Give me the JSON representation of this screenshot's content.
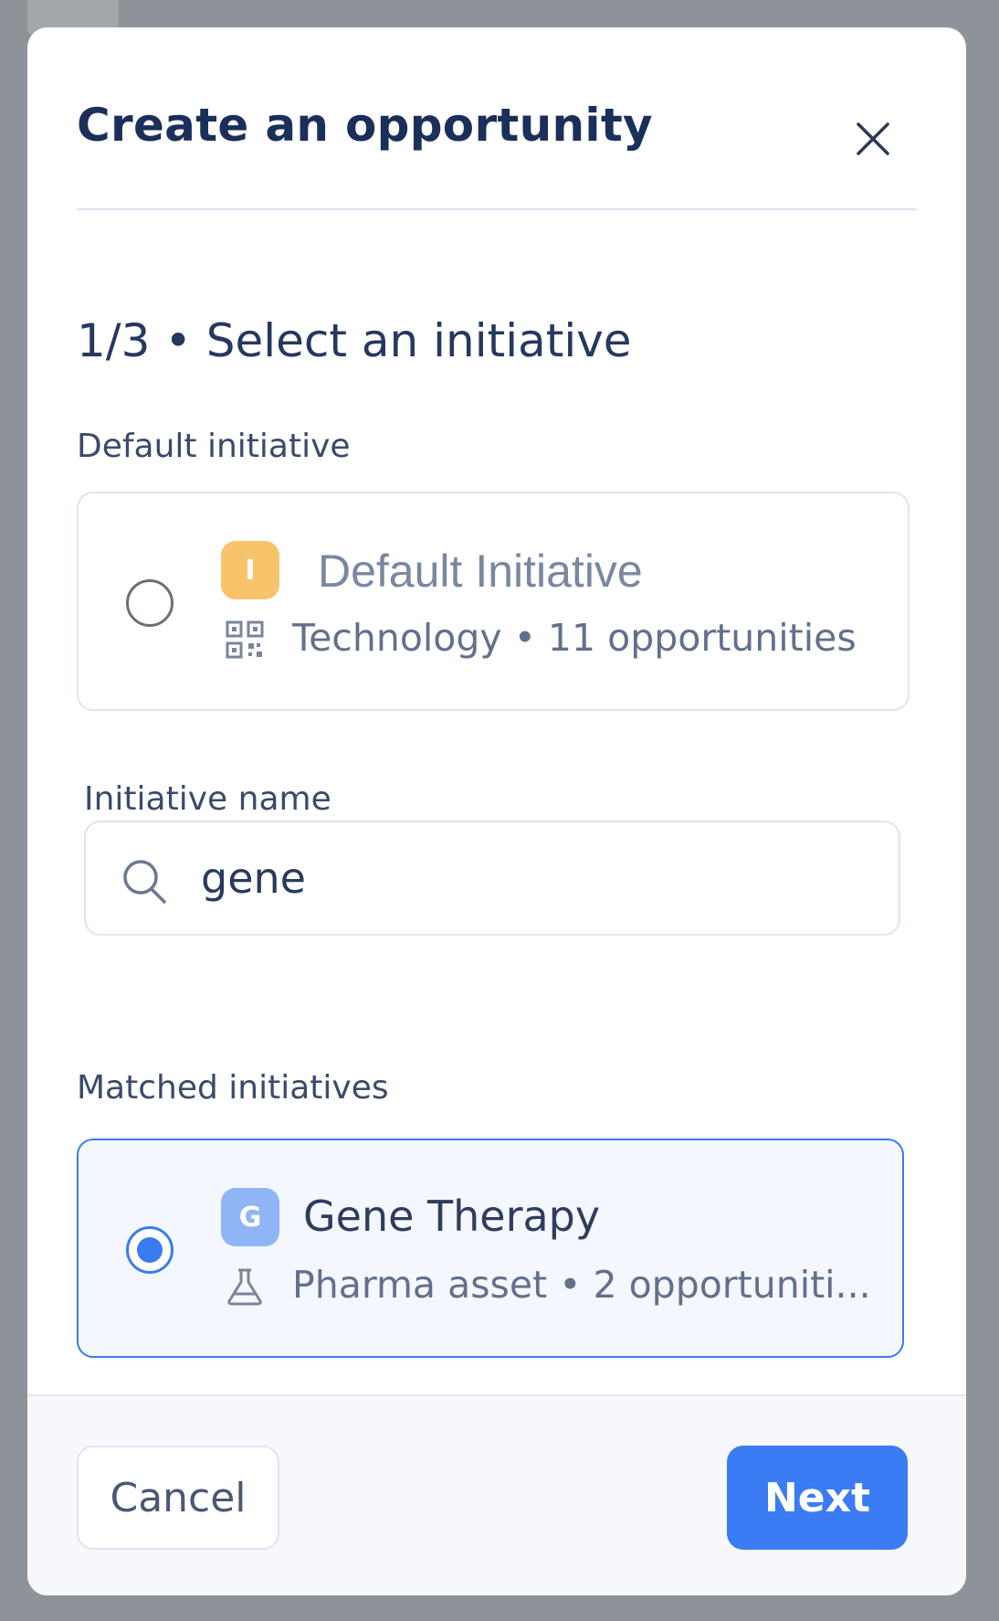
{
  "modal": {
    "title": "Create an opportunity",
    "step_title": "1/3 • Select an initiative"
  },
  "default_section": {
    "label": "Default initiative",
    "card": {
      "avatar_letter": "I",
      "avatar_color": "#f7c46c",
      "name": "Default Initiative",
      "meta_icon": "qr-code-icon",
      "meta": "Technology • 11 opportunities",
      "selected": false
    }
  },
  "search": {
    "label": "Initiative name",
    "value": "gene"
  },
  "matched_section": {
    "label": "Matched initiatives",
    "card": {
      "avatar_letter": "G",
      "avatar_color": "#8fb5f7",
      "name": "Gene Therapy",
      "meta_icon": "flask-icon",
      "meta": "Pharma asset • 2 opportuniti...",
      "selected": true
    }
  },
  "footer": {
    "cancel_label": "Cancel",
    "next_label": "Next"
  },
  "colors": {
    "accent": "#3b7cf4",
    "title": "#1a2f5a",
    "overlay": "#8e9299"
  }
}
